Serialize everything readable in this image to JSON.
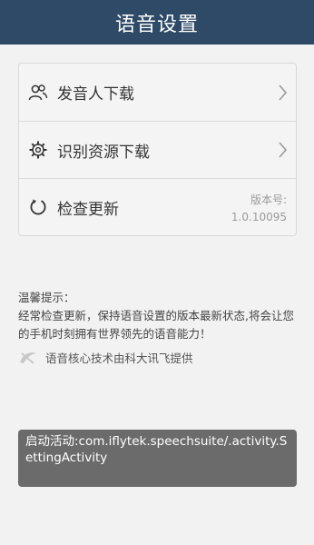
{
  "title": "语音设置",
  "menu": {
    "speaker_download": {
      "label": "发音人下载",
      "icon": "people-icon"
    },
    "resource_download": {
      "label": "识别资源下载",
      "icon": "gear-icon"
    },
    "check_update": {
      "label": "检查更新",
      "icon": "refresh-icon",
      "version_label": "版本号:",
      "version_value": "1.0.10095"
    }
  },
  "tips": {
    "heading": "温馨提示：",
    "body": "经常检查更新，保持语音设置的版本最新状态,将会让您的手机时刻拥有世界领先的语音能力！"
  },
  "credit": {
    "text": "语音核心技术由科大讯飞提供",
    "icon": "iflytek-logo-icon"
  },
  "toast": {
    "text": "启动活动:com.iflytek.speechsuite/.activity.SettingActivity"
  },
  "colors": {
    "titlebar": "#2e4a66",
    "toast": "#6b6b6b"
  }
}
